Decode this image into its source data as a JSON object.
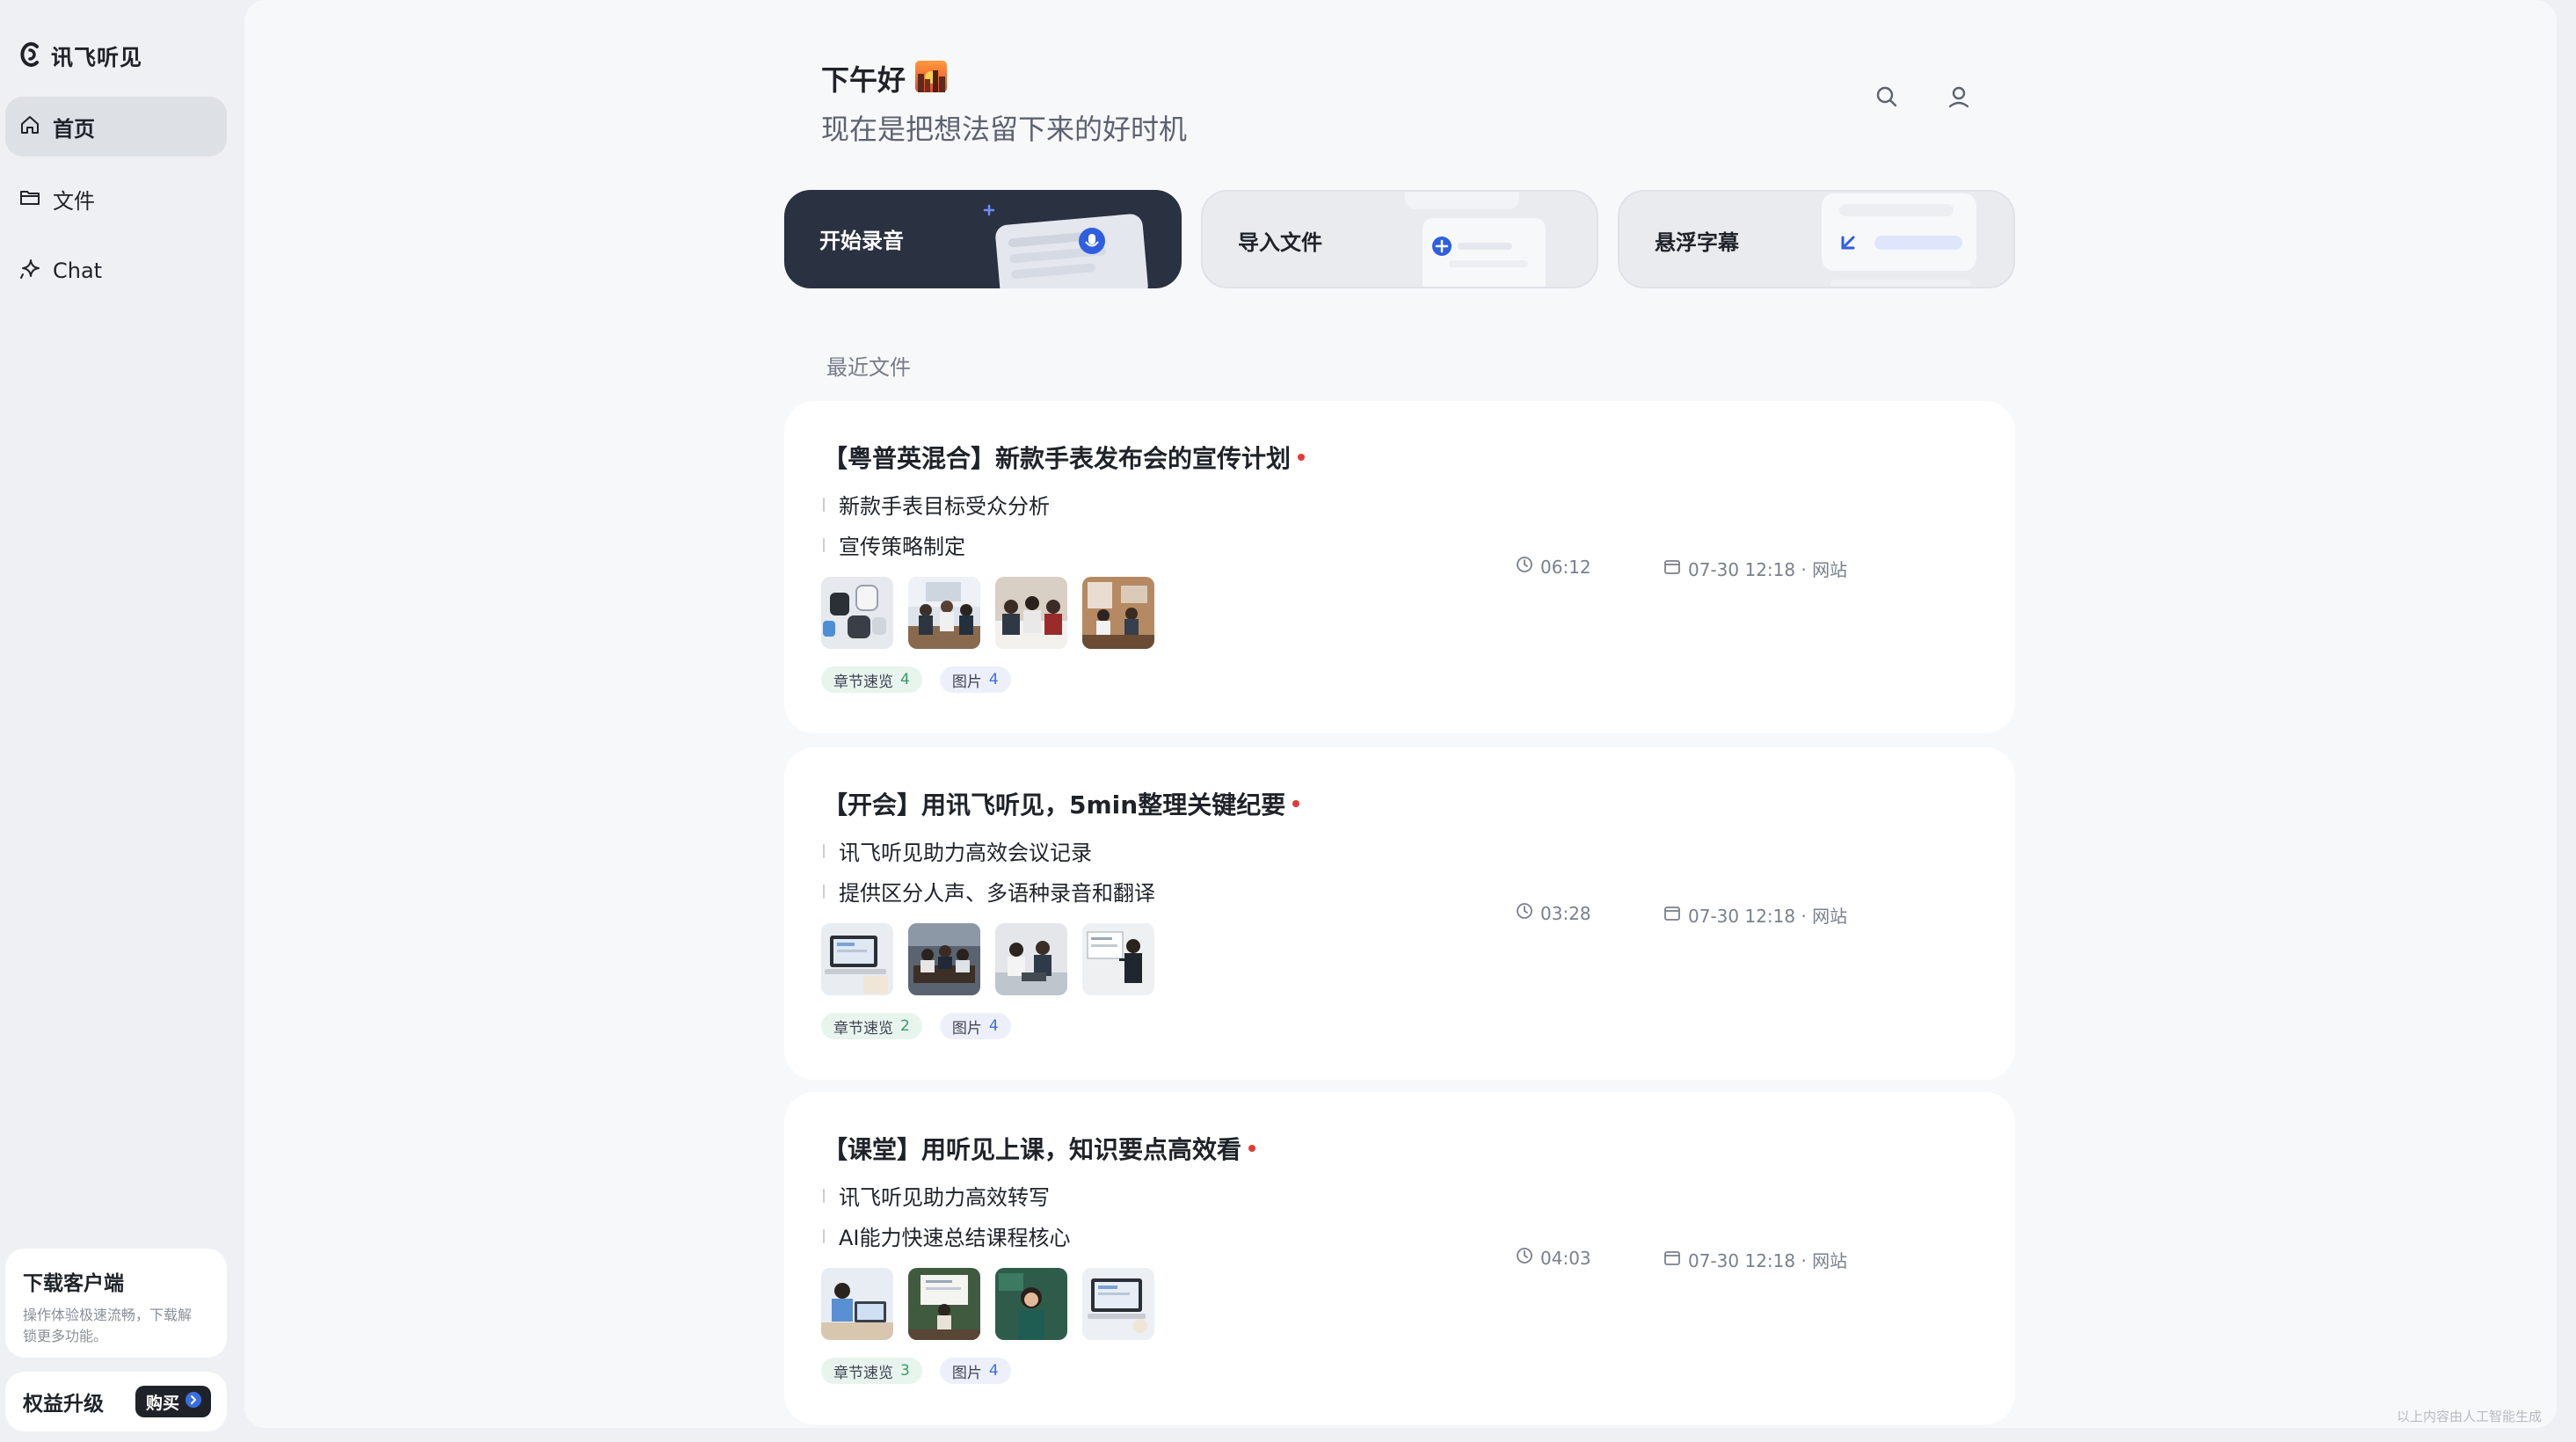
{
  "app": {
    "brand_name": "讯飞听见",
    "colors": {
      "accent": "#3b6fe0",
      "dark_card": "#2a3140",
      "unread_dot": "#e53935"
    }
  },
  "sidebar": {
    "items": [
      {
        "label": "首页",
        "icon": "home-icon",
        "active": true
      },
      {
        "label": "文件",
        "icon": "folder-icon",
        "active": false
      },
      {
        "label": "Chat",
        "icon": "sparkle-icon",
        "active": false
      }
    ],
    "download": {
      "title": "下载客户端",
      "desc_line1": "操作体验极速流畅，下载解",
      "desc_line2": "锁更多功能。"
    },
    "upgrade": {
      "label": "权益升级",
      "buy_label": "购买"
    }
  },
  "header": {
    "greeting": "下午好",
    "subtitle": "现在是把想法留下来的好时机",
    "icons": [
      "search-icon",
      "user-icon"
    ]
  },
  "actions": [
    {
      "label": "开始录音",
      "icon": "microphone-icon"
    },
    {
      "label": "导入文件",
      "icon": "plus-icon"
    },
    {
      "label": "悬浮字幕",
      "icon": "subtitle-icon"
    }
  ],
  "recent": {
    "title": "最近文件",
    "files": [
      {
        "title": "【粤普英混合】新款手表发布会的宣传计划",
        "bullets": [
          "新款手表目标受众分析",
          "宣传策略制定"
        ],
        "thumbnails": [
          "photo-smartwatches",
          "photo-meeting-room",
          "photo-team-discussion",
          "photo-office-presentation"
        ],
        "tags": [
          {
            "label": "章节速览",
            "count": "4"
          },
          {
            "label": "图片",
            "count": "4"
          }
        ],
        "duration": "06:12",
        "date_source": "07-30 12:18 · 网站"
      },
      {
        "title": "【开会】用讯飞听见，5min整理关键纪要",
        "bullets": [
          "讯飞听见助力高效会议记录",
          "提供区分人声、多语种录音和翻译"
        ],
        "thumbnails": [
          "photo-laptop-notes",
          "photo-conference-table",
          "photo-colleagues-laptop",
          "photo-presenter-board"
        ],
        "tags": [
          {
            "label": "章节速览",
            "count": "2"
          },
          {
            "label": "图片",
            "count": "4"
          }
        ],
        "duration": "03:28",
        "date_source": "07-30 12:18 · 网站"
      },
      {
        "title": "【课堂】用听见上课，知识要点高效看",
        "bullets": [
          "讯飞听见助力高效转写",
          "AI能力快速总结课程核心"
        ],
        "thumbnails": [
          "photo-student-laptop",
          "photo-classroom-lecture",
          "photo-teacher-portrait",
          "photo-online-class"
        ],
        "tags": [
          {
            "label": "章节速览",
            "count": "3"
          },
          {
            "label": "图片",
            "count": "4"
          }
        ],
        "duration": "04:03",
        "date_source": "07-30 12:18 · 网站"
      }
    ]
  },
  "footer": {
    "note": "以上内容由人工智能生成"
  }
}
